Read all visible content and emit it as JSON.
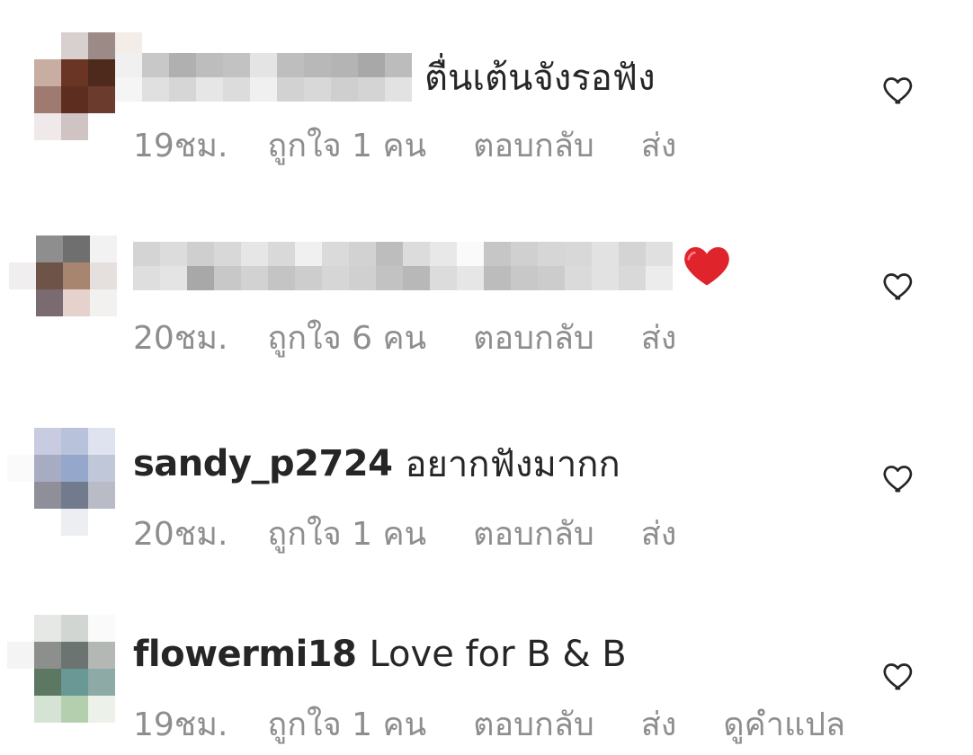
{
  "comments": [
    {
      "username": "",
      "text": "ตื่นเต้นจังรอฟัง",
      "time": "19ชม.",
      "likes": "ถูกใจ 1 คน",
      "reply": "ตอบกลับ",
      "send": "ส่ง",
      "translate": ""
    },
    {
      "username": "",
      "text": "",
      "time": "20ชม.",
      "likes": "ถูกใจ 6 คน",
      "reply": "ตอบกลับ",
      "send": "ส่ง",
      "translate": ""
    },
    {
      "username": "sandy_p2724",
      "text": "อยากฟังมากก",
      "time": "20ชม.",
      "likes": "ถูกใจ 1 คน",
      "reply": "ตอบกลับ",
      "send": "ส่ง",
      "translate": ""
    },
    {
      "username": "flowermi18",
      "text": "Love for B & B",
      "time": "19ชม.",
      "likes": "ถูกใจ 1 คน",
      "reply": "ตอบกลับ",
      "send": "ส่ง",
      "translate": "ดูคำแปล"
    }
  ],
  "icons": {
    "like": "heart-outline-icon",
    "emoji": "red-heart-emoji"
  },
  "colors": {
    "text": "#262626",
    "meta": "#8e8e8e",
    "heart": "#e0242c"
  }
}
